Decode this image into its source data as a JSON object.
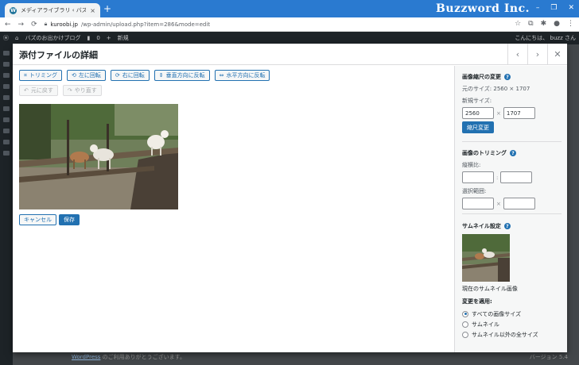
{
  "browser": {
    "tab_title": "メディアライブラリ ‹ バズのお出かけブロ",
    "tab_close": "×",
    "new_tab": "+",
    "brand": "Buzzword Inc.",
    "window_controls": [
      "–",
      "❐",
      "✕"
    ],
    "nav": [
      "←",
      "→",
      "⟳"
    ],
    "url_domain": "kuroobi.jp",
    "url_path": "/wp-admin/upload.php?item=286&mode=edit",
    "toolbar_icons": [
      "☆",
      "⧉",
      "✱",
      "●",
      "⋮"
    ]
  },
  "wpbar": {
    "site_name": "バズのお出かけブログ",
    "comments": "0",
    "new": "新規",
    "greeting": "こんにちは、 buzz さん"
  },
  "footer": {
    "link": "WordPress",
    "text": " のご利用ありがとうございます。",
    "version": "バージョン 5.4"
  },
  "modal": {
    "title": "添付ファイルの詳細",
    "prev": "‹",
    "next": "›",
    "close": "✕"
  },
  "toolbar": {
    "crop": "トリミング",
    "rotate_left": "左に回転",
    "rotate_right": "右に回転",
    "flip_vertical": "垂直方向に反転",
    "flip_horizontal": "水平方向に反転",
    "undo": "元に戻す",
    "redo": "やり直す"
  },
  "actions": {
    "cancel": "キャンセル",
    "save": "保存"
  },
  "scale": {
    "title": "画像縮尺の変更",
    "original_size": "元のサイズ: 2560 × 1707",
    "new_size_label": "新規サイズ:",
    "width": "2560",
    "height": "1707",
    "times": "×",
    "button": "縮尺変更"
  },
  "crop": {
    "title": "画像のトリミング",
    "ratio_label": "縦横比:",
    "ratio_sep": ":",
    "selection_label": "選択範囲:",
    "selection_sep": "×"
  },
  "thumbnail": {
    "title": "サムネイル設定",
    "caption": "現在のサムネイル画像",
    "apply_label": "変更を適用:",
    "options": [
      "すべての画像サイズ",
      "サムネイル",
      "サムネイル以外の全サイズ"
    ],
    "selected_index": 0
  },
  "colors": {
    "accent": "#2271b1",
    "admin_bar": "#1d2327",
    "chrome_tab_bar": "#2a7ad0"
  }
}
